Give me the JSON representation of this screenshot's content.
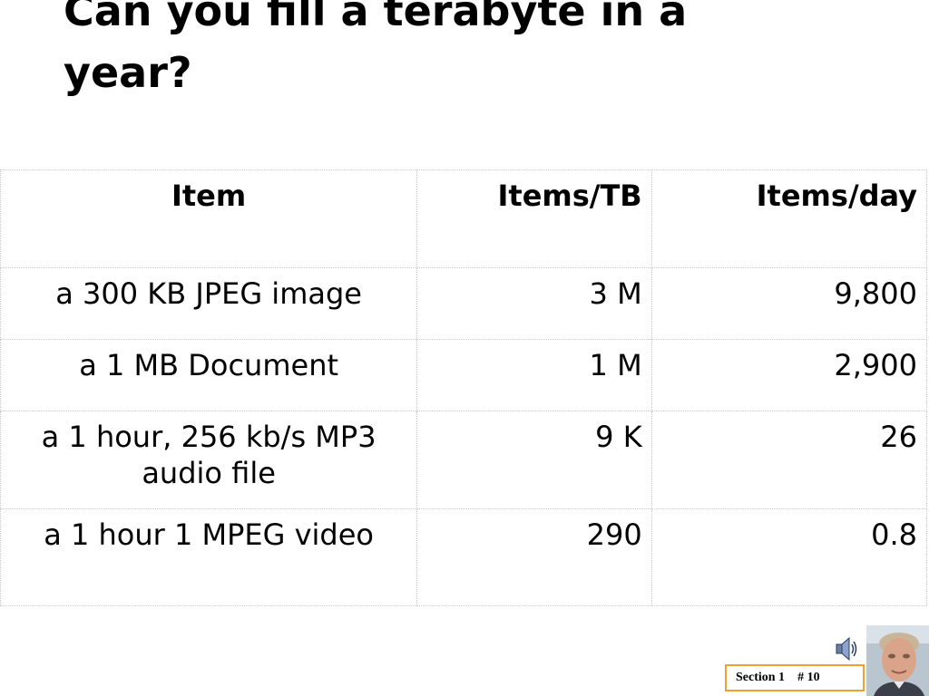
{
  "slide": {
    "title": "Can you fill a terabyte in a year?"
  },
  "table": {
    "headers": [
      "Item",
      "Items/TB",
      "Items/day"
    ],
    "rows": [
      [
        "a 300 KB JPEG image",
        "3 M",
        "9,800"
      ],
      [
        "a 1 MB Document",
        "1 M",
        "2,900"
      ],
      [
        "a 1 hour, 256 kb/s MP3 audio file",
        "9 K",
        "26"
      ],
      [
        "a 1 hour 1 MPEG video",
        "290",
        "0.8"
      ]
    ]
  },
  "footer": {
    "section": "Section 1",
    "page": "# 10"
  },
  "icons": {
    "speaker": "speaker-icon",
    "photo": "presenter-photo"
  },
  "colors": {
    "footer_border": "#f0a030",
    "grid": "#c8c8c8"
  }
}
